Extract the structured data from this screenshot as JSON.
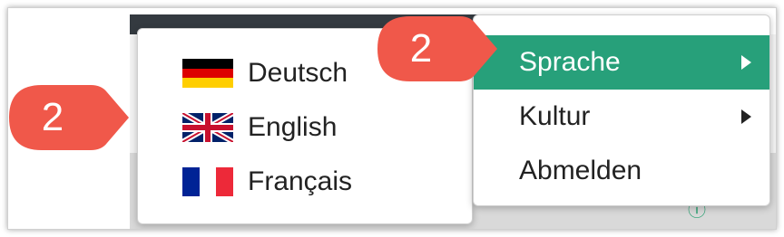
{
  "language_menu": {
    "items": [
      {
        "label": "Deutsch",
        "flag": "flag-germany-icon"
      },
      {
        "label": "English",
        "flag": "flag-uk-icon"
      },
      {
        "label": "Français",
        "flag": "flag-france-icon"
      }
    ]
  },
  "user_menu": {
    "items": [
      {
        "label": "Sprache",
        "has_submenu": true,
        "active": true
      },
      {
        "label": "Kultur",
        "has_submenu": true,
        "active": false
      },
      {
        "label": "Abmelden",
        "has_submenu": false,
        "active": false
      }
    ]
  },
  "callouts": [
    {
      "number": "2"
    },
    {
      "number": "2"
    }
  ],
  "colors": {
    "accent": "#27a07a",
    "callout": "#f0584a",
    "header": "#343a40"
  }
}
